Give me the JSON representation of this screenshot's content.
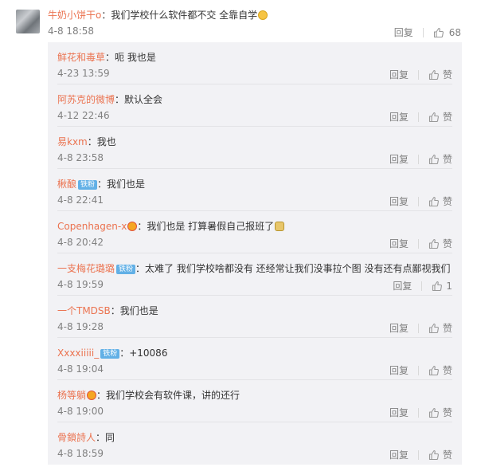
{
  "top_comment": {
    "user": "牛奶小饼干o",
    "text": "：我们学校什么软件都不交 全靠自学",
    "time": "4-8 18:58",
    "reply_label": "回复",
    "like_count": "68"
  },
  "replies": [
    {
      "user": "鲜花和毒草",
      "badge": "",
      "text": "：呃 我也是",
      "time": "4-23 13:59",
      "reply_label": "回复",
      "like_label": "赞"
    },
    {
      "user": "阿苏克的微博",
      "badge": "",
      "text": "：默认全会",
      "time": "4-12 22:46",
      "reply_label": "回复",
      "like_label": "赞"
    },
    {
      "user": "易kxm",
      "badge": "",
      "text": "：我也",
      "time": "4-8 23:58",
      "reply_label": "回复",
      "like_label": "赞"
    },
    {
      "user": "楸酿",
      "badge": "铁粉",
      "text": "：我们也是",
      "time": "4-8 22:41",
      "reply_label": "回复",
      "like_label": "赞"
    },
    {
      "user": "Copenhagen-x",
      "badge": "",
      "text": "：我们也是  打算暑假自己报班了",
      "time": "4-8 20:42",
      "reply_label": "回复",
      "like_label": "赞"
    },
    {
      "user": "一支梅花璐璐",
      "badge": "铁粉",
      "text": "：太难了 我们学校啥都没有 还经常让我们没事拉个图 没有还有点鄙视我们",
      "time": "4-8 19:59",
      "reply_label": "回复",
      "like_label": "1"
    },
    {
      "user": "一个TMDSB",
      "badge": "",
      "text": "：我们也是",
      "time": "4-8 19:28",
      "reply_label": "回复",
      "like_label": "赞"
    },
    {
      "user": "Xxxxiiiii_",
      "badge": "铁粉",
      "text": "：+10086",
      "time": "4-8 19:04",
      "reply_label": "回复",
      "like_label": "赞"
    },
    {
      "user": "杨等躺",
      "badge": "",
      "text": "：我们学校会有软件课，讲的还行",
      "time": "4-8 19:00",
      "reply_label": "回复",
      "like_label": "赞"
    },
    {
      "user": "骨鎖詩人",
      "badge": "",
      "text": "：同",
      "time": "4-8 18:59",
      "reply_label": "回复",
      "like_label": "赞"
    }
  ]
}
